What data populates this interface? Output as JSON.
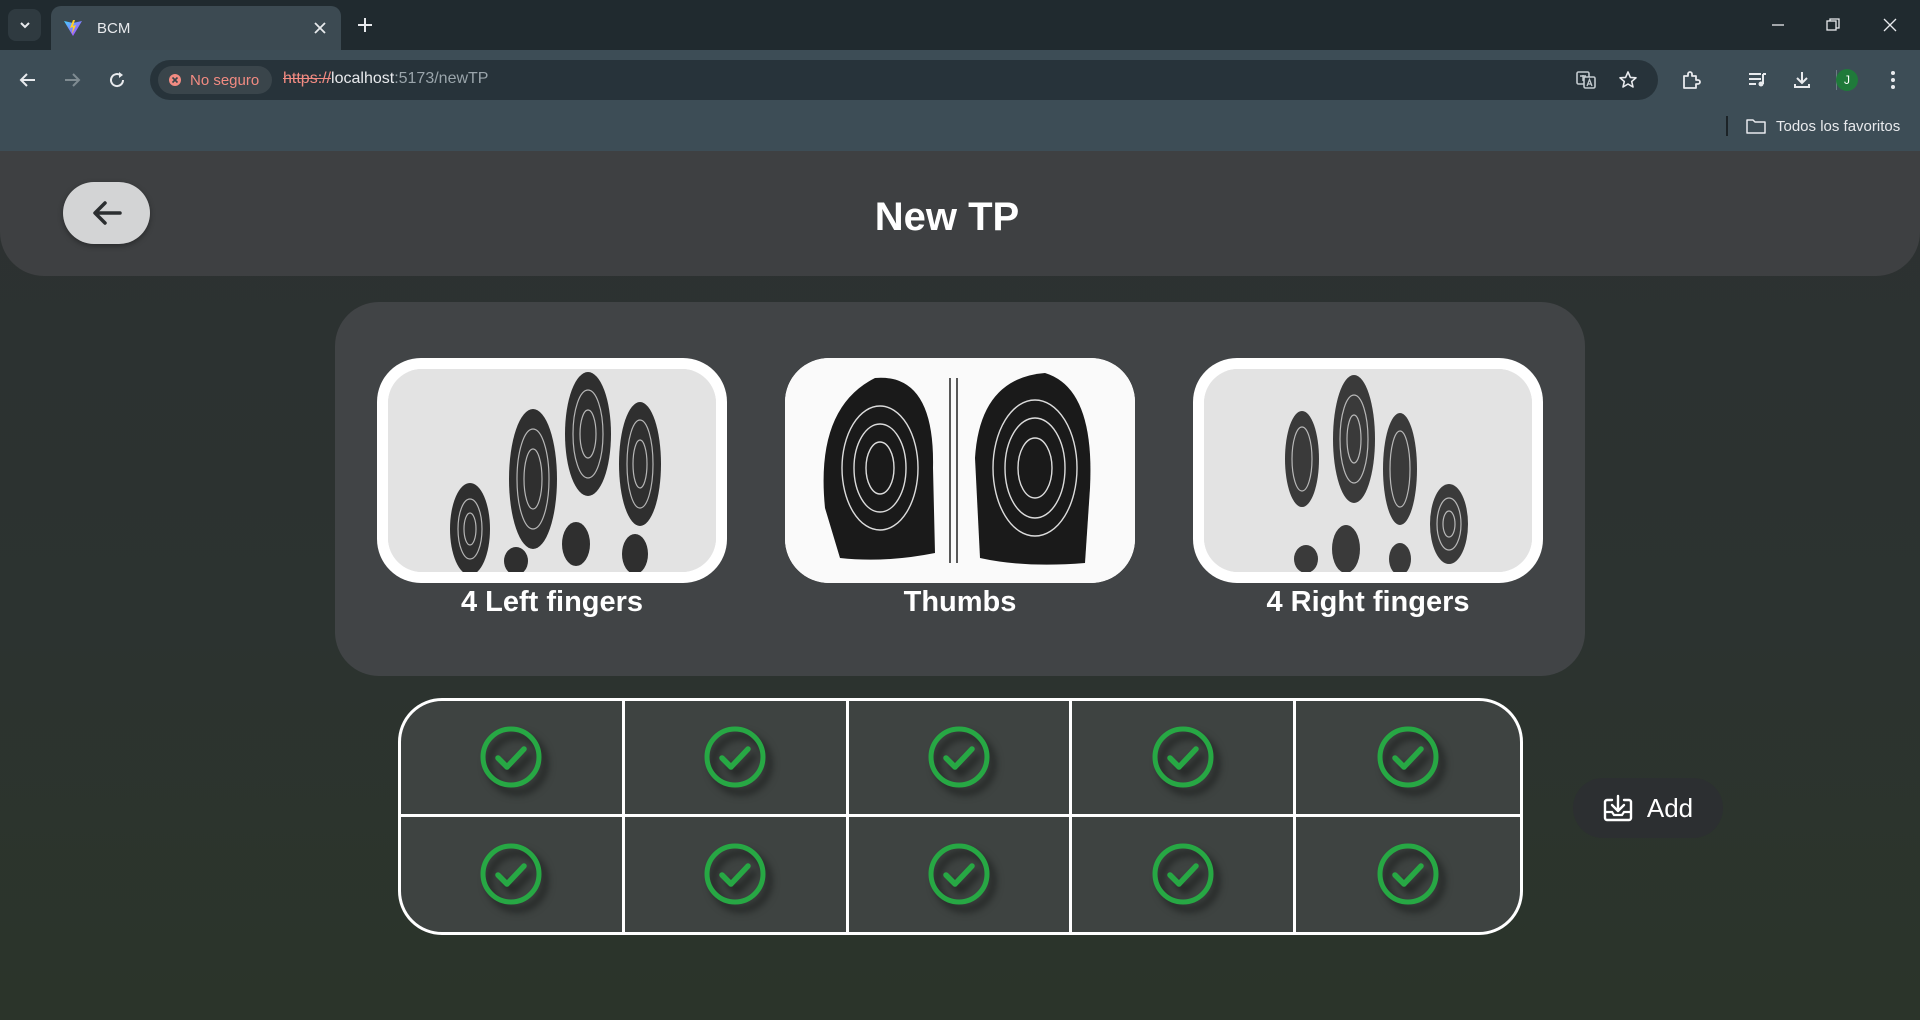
{
  "browser": {
    "tab_title": "BCM",
    "security_label": "No seguro",
    "url_scheme": "https://",
    "url_host": "localhost",
    "url_path": ":5173/newTP",
    "bookmarks_label": "Todos los favoritos",
    "profile_initial": "J",
    "accent_color": "#1f7a3a"
  },
  "header": {
    "title": "New TP",
    "back_icon": "arrow-left-icon"
  },
  "capture": {
    "cards": [
      {
        "label": "4 Left fingers",
        "image": "left-fingers-image"
      },
      {
        "label": "Thumbs",
        "image": "thumbs-image"
      },
      {
        "label": "4 Right fingers",
        "image": "right-fingers-image"
      }
    ]
  },
  "fingers": {
    "status_icon": "check-circle-icon",
    "status_color": "#27a844",
    "rows": [
      [
        "captured",
        "captured",
        "captured",
        "captured",
        "captured"
      ],
      [
        "captured",
        "captured",
        "captured",
        "captured",
        "captured"
      ]
    ]
  },
  "actions": {
    "add_label": "Add",
    "add_icon": "download-tray-icon"
  }
}
